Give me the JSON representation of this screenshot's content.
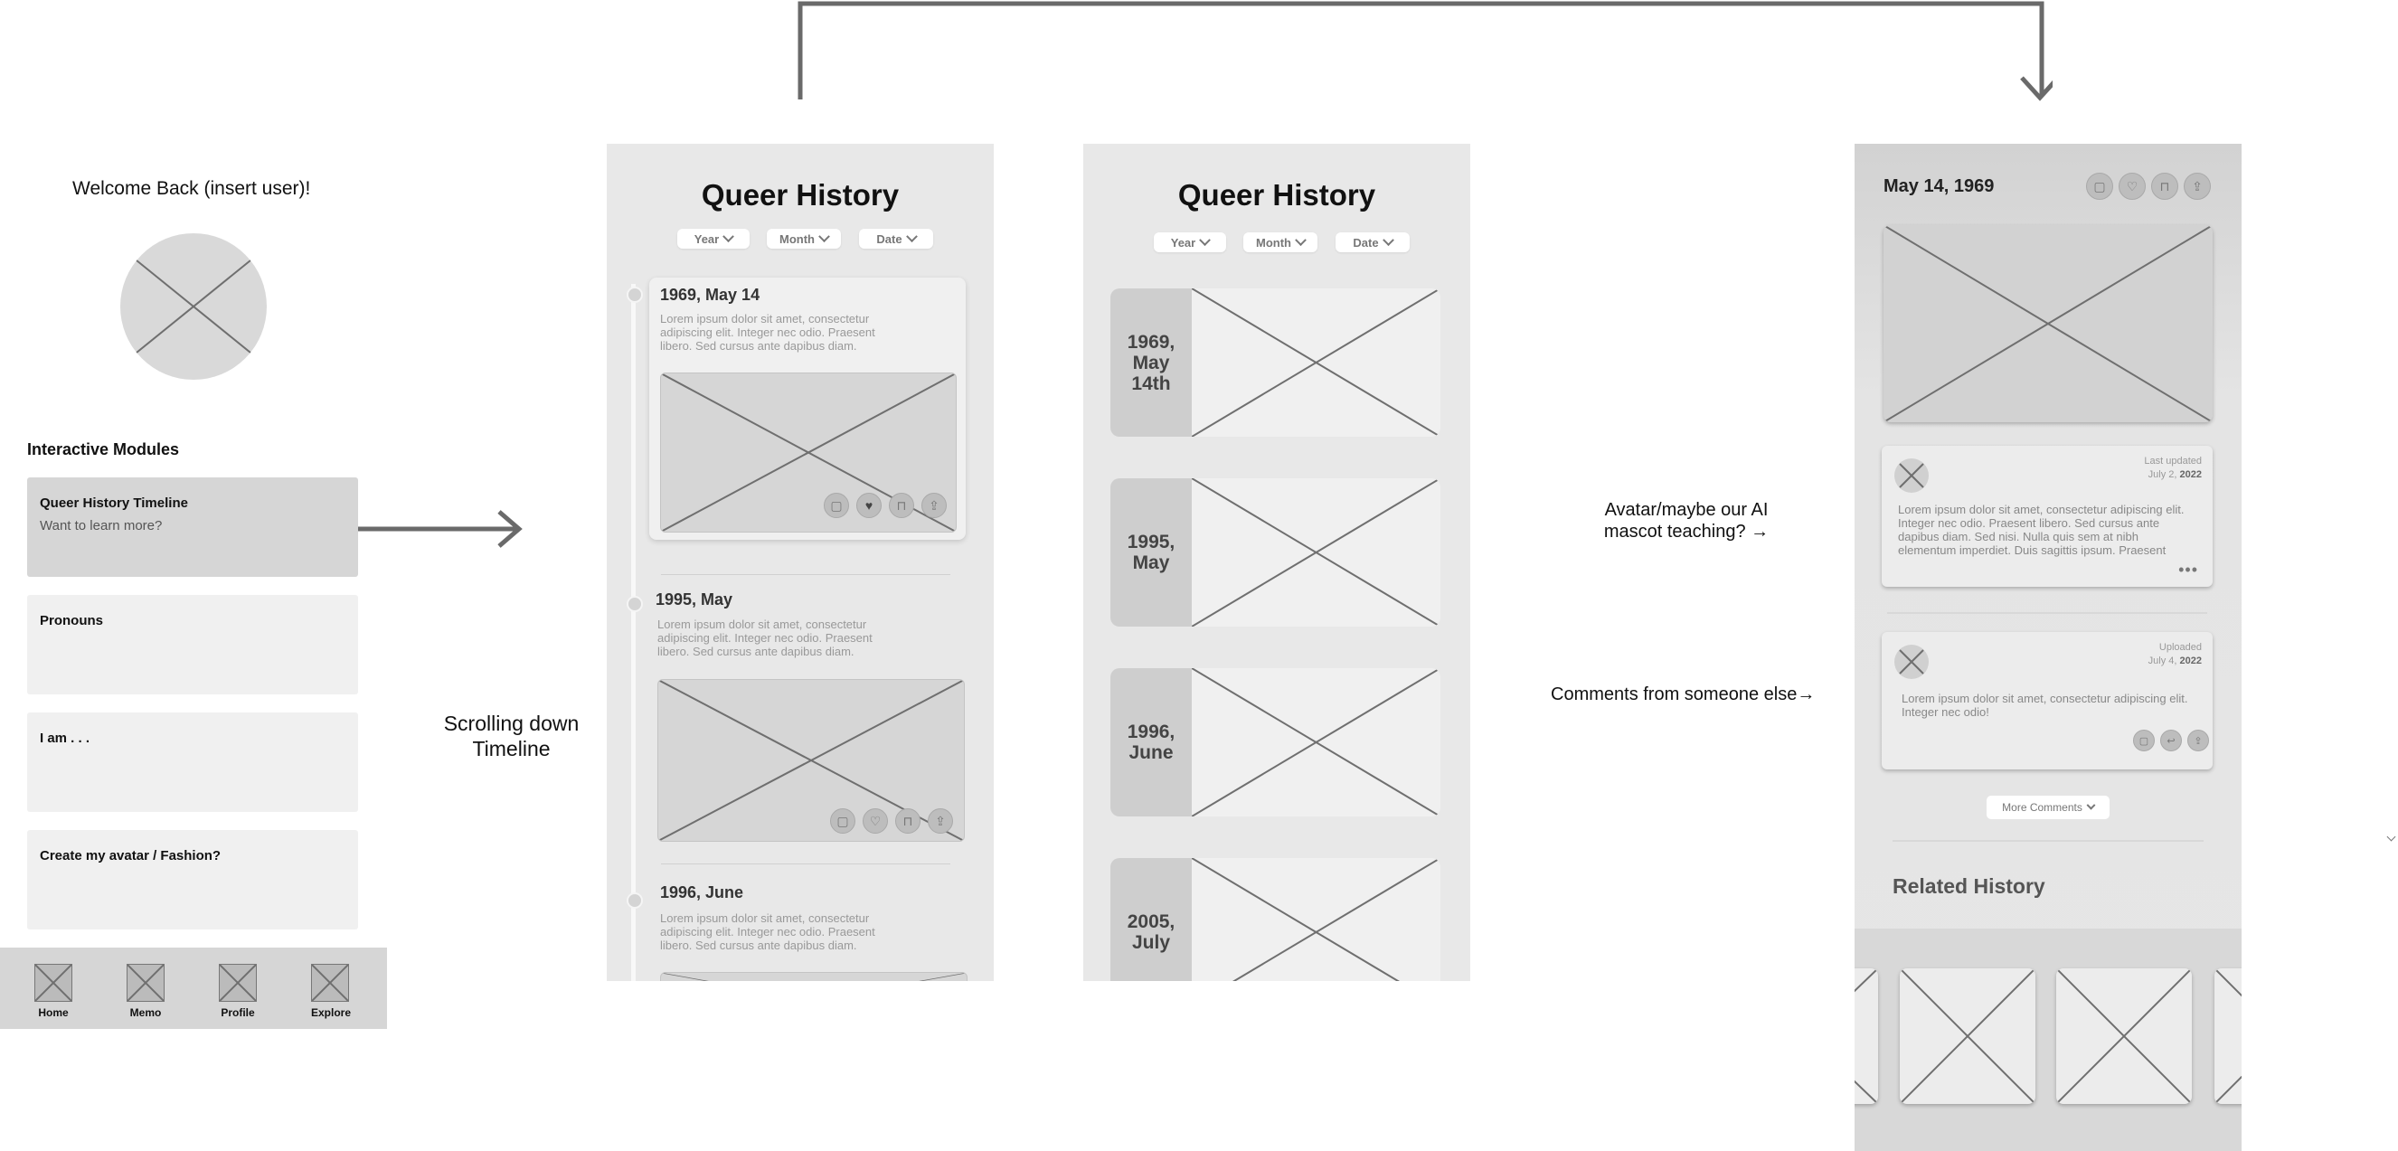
{
  "home": {
    "welcome": "Welcome Back (insert user)!",
    "section_title": "Interactive Modules",
    "modules": [
      {
        "title": "Queer History Timeline",
        "subtitle": "Want to learn more?"
      },
      {
        "title": "Pronouns",
        "subtitle": ""
      },
      {
        "title": "I am . . .",
        "subtitle": ""
      },
      {
        "title": "Create my avatar / Fashion?",
        "subtitle": ""
      }
    ],
    "nav": [
      "Home",
      "Memo",
      "Profile",
      "Explore"
    ]
  },
  "annotations": {
    "scrolling": "Scrolling down Timeline",
    "avatar": "Avatar/maybe our AI mascot teaching? →",
    "comments": "Comments from someone else→"
  },
  "timeline": {
    "title": "Queer History",
    "filters": [
      "Year",
      "Month",
      "Date"
    ],
    "entries": [
      {
        "date": "1969, May 14",
        "text": "Lorem ipsum dolor sit amet, consectetur adipiscing elit. Integer nec odio. Praesent libero. Sed cursus ante dapibus diam."
      },
      {
        "date": "1995, May",
        "text": "Lorem ipsum dolor sit amet, consectetur adipiscing elit. Integer nec odio. Praesent libero. Sed cursus ante dapibus diam."
      },
      {
        "date": "1996, June",
        "text": "Lorem ipsum dolor sit amet, consectetur adipiscing elit. Integer nec odio. Praesent libero. Sed cursus ante dapibus diam."
      }
    ]
  },
  "cards": {
    "title": "Queer History",
    "filters": [
      "Year",
      "Month",
      "Date"
    ],
    "items": [
      "1969, May 14th",
      "1995, May",
      "1996, June",
      "2005, July"
    ]
  },
  "detail": {
    "date": "May 14, 1969",
    "comments": [
      {
        "meta_label": "Last updated",
        "meta_date": "July 2, ",
        "meta_year": "2022",
        "text": "Lorem ipsum dolor sit amet, consectetur adipiscing elit. Integer nec odio. Praesent libero. Sed cursus ante dapibus diam. Sed nisi. Nulla quis sem at nibh elementum imperdiet. Duis sagittis ipsum. Praesent"
      },
      {
        "meta_label": "Uploaded",
        "meta_date": "July 4, ",
        "meta_year": "2022",
        "text": "Lorem ipsum dolor sit amet, consectetur adipiscing elit. Integer nec odio!"
      }
    ],
    "more_comments": "More Comments",
    "related_title": "Related History"
  }
}
